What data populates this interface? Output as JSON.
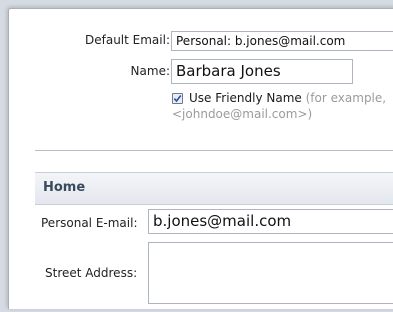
{
  "account": {
    "default_email_label": "Default Email:",
    "default_email_value": "Personal: b.jones@mail.com",
    "name_label": "Name:",
    "name_value": "Barbara Jones",
    "use_friendly_name_checked": true,
    "use_friendly_name_label": "Use Friendly Name",
    "hint_line1": "(for example,",
    "hint_line2": "<johndoe@mail.com>)"
  },
  "home": {
    "section_title": "Home",
    "personal_email_label": "Personal E-mail:",
    "personal_email_value": "b.jones@mail.com",
    "street_address_label": "Street Address:",
    "street_address_value": ""
  }
}
